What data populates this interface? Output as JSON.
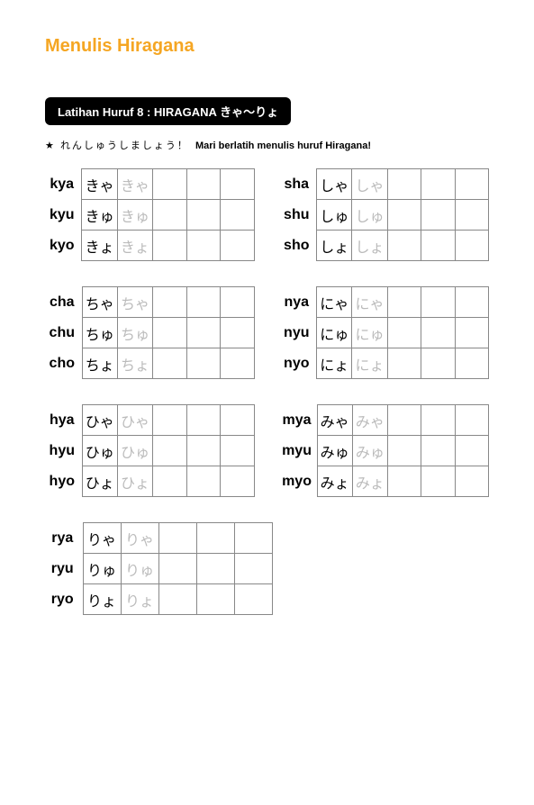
{
  "title": "Menulis Hiragana",
  "lesson_badge": "Latihan Huruf 8 : HIRAGANA きゃ～りょ",
  "instruction": {
    "star": "★",
    "jp": "れんしゅうしましょう！",
    "text": "Mari berlatih menulis huruf Hiragana!"
  },
  "pairs": [
    {
      "left": [
        {
          "label": "kya",
          "char": "きゃ",
          "trace": "きゃ"
        },
        {
          "label": "kyu",
          "char": "きゅ",
          "trace": "きゅ"
        },
        {
          "label": "kyo",
          "char": "きょ",
          "trace": "きょ"
        }
      ],
      "right": [
        {
          "label": "sha",
          "char": "しゃ",
          "trace": "しゃ"
        },
        {
          "label": "shu",
          "char": "しゅ",
          "trace": "しゅ"
        },
        {
          "label": "sho",
          "char": "しょ",
          "trace": "しょ"
        }
      ]
    },
    {
      "left": [
        {
          "label": "cha",
          "char": "ちゃ",
          "trace": "ちゃ"
        },
        {
          "label": "chu",
          "char": "ちゅ",
          "trace": "ちゅ"
        },
        {
          "label": "cho",
          "char": "ちょ",
          "trace": "ちょ"
        }
      ],
      "right": [
        {
          "label": "nya",
          "char": "にゃ",
          "trace": "にゃ"
        },
        {
          "label": "nyu",
          "char": "にゅ",
          "trace": "にゅ"
        },
        {
          "label": "nyo",
          "char": "にょ",
          "trace": "にょ"
        }
      ]
    },
    {
      "left": [
        {
          "label": "hya",
          "char": "ひゃ",
          "trace": "ひゃ"
        },
        {
          "label": "hyu",
          "char": "ひゅ",
          "trace": "ひゅ"
        },
        {
          "label": "hyo",
          "char": "ひょ",
          "trace": "ひょ"
        }
      ],
      "right": [
        {
          "label": "mya",
          "char": "みゃ",
          "trace": "みゃ"
        },
        {
          "label": "myu",
          "char": "みゅ",
          "trace": "みゅ"
        },
        {
          "label": "myo",
          "char": "みょ",
          "trace": "みょ"
        }
      ]
    },
    {
      "left": [
        {
          "label": "rya",
          "char": "りゃ",
          "trace": "りゃ"
        },
        {
          "label": "ryu",
          "char": "りゅ",
          "trace": "りゅ"
        },
        {
          "label": "ryo",
          "char": "りょ",
          "trace": "りょ"
        }
      ],
      "right": null
    }
  ]
}
